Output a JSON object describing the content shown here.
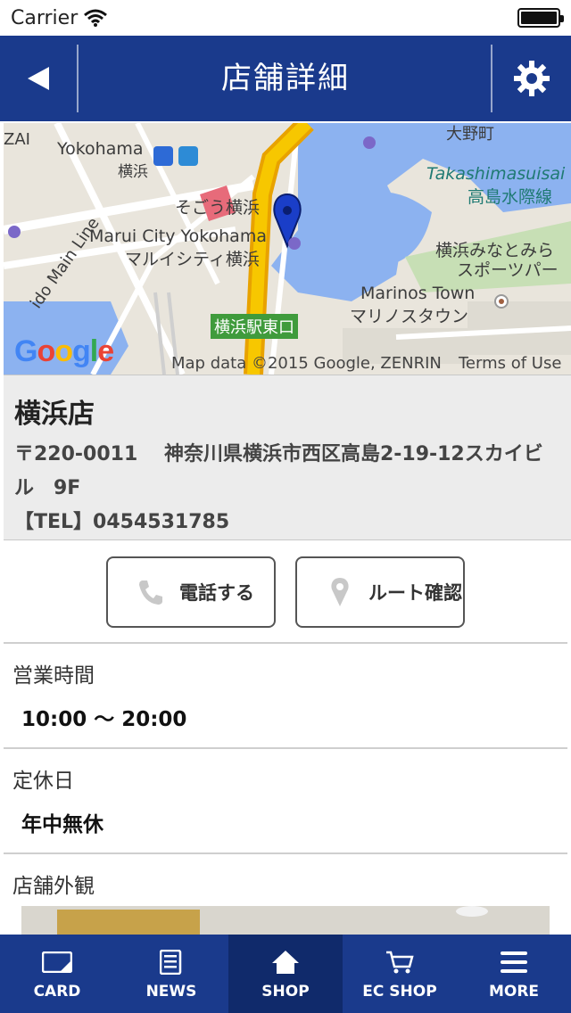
{
  "status": {
    "carrier": "Carrier"
  },
  "nav": {
    "title": "店舗詳細",
    "back_icon": "back-arrow-icon",
    "settings_icon": "gear-icon"
  },
  "map": {
    "labels": {
      "yokohama": "Yokohama",
      "yokohama_jp": "横浜",
      "sogo": "そごう横浜",
      "marui_en": "Marui City Yokohama",
      "marui_jp": "マルイシティ横浜",
      "takashima_en": "Takashimasuisai",
      "takashima_jp": "高島水際線",
      "minatomirai": "横浜みなとみら",
      "sportspark": "スポーツパー",
      "marinos_en": "Marinos Town",
      "marinos_jp": "マリノスタウン",
      "east_exit": "横浜駅東口",
      "main_line": "ido Main Line",
      "ai": "ZAI",
      "nomachi": "大野町"
    },
    "credit": "Map data ©2015 Google, ZENRIN",
    "terms": "Terms of Use",
    "logo": "Google"
  },
  "shop": {
    "name": "横浜店",
    "address_line1": "〒220-0011　 神奈川県横浜市西区高島2-19-12スカイビ",
    "address_line2": "ル　9F",
    "tel": "【TEL】0454531785"
  },
  "actions": {
    "call": "電話する",
    "route": "ルート確認"
  },
  "sections": {
    "hours_title": "営業時間",
    "hours_value": "10:00 〜 20:00",
    "holiday_title": "定休日",
    "holiday_value": "年中無休",
    "exterior_title": "店舗外観"
  },
  "tabs": [
    {
      "label": "CARD",
      "icon": "card-icon"
    },
    {
      "label": "NEWS",
      "icon": "news-icon"
    },
    {
      "label": "SHOP",
      "icon": "home-icon",
      "active": true
    },
    {
      "label": "EC SHOP",
      "icon": "cart-icon"
    },
    {
      "label": "MORE",
      "icon": "menu-icon"
    }
  ],
  "colors": {
    "nav_bg": "#1a3a8c",
    "tab_active": "#102a6b"
  }
}
